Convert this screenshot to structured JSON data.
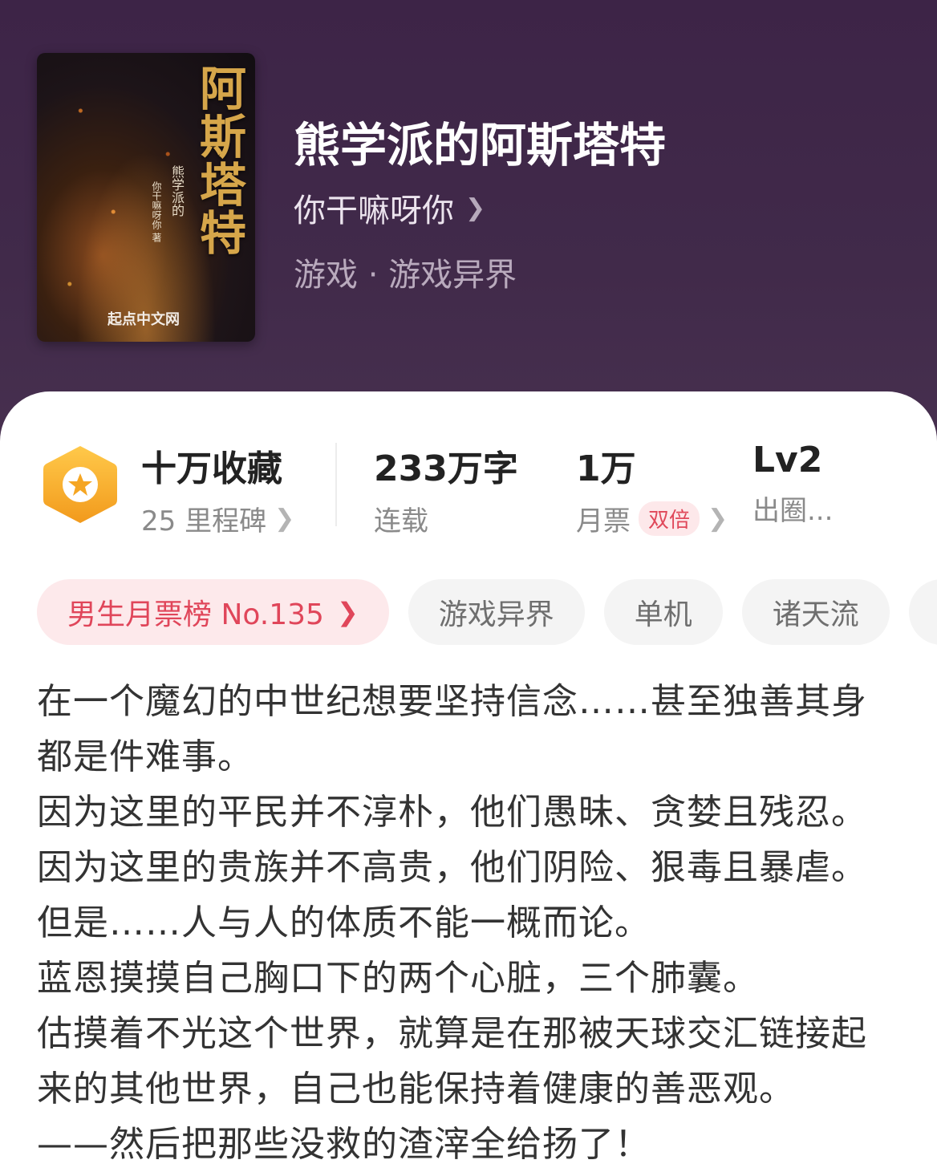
{
  "book": {
    "title": "熊学派的阿斯塔特",
    "author": "你干嘛呀你",
    "category": "游戏 · 游戏异界"
  },
  "cover": {
    "title": "阿斯塔特",
    "subtitle": "熊学派的",
    "author": "你干嘛呀你 著",
    "publisher_logo": "起点中文网"
  },
  "stats": {
    "collection": {
      "value": "十万收藏",
      "label": "25 里程碑"
    },
    "words": {
      "value": "233万字",
      "label": "连载"
    },
    "tickets": {
      "value": "1万",
      "label": "月票",
      "tag": "双倍"
    },
    "level": {
      "value": "Lv2",
      "label": "出圈..."
    }
  },
  "chips": [
    "男生月票榜 No.135",
    "游戏异界",
    "单机",
    "诸天流",
    "…"
  ],
  "intro": [
    "在一个魔幻的中世纪想要坚持信念……甚至独善其身",
    "都是件难事。",
    "因为这里的平民并不淳朴，他们愚昧、贪婪且残忍。",
    "因为这里的贵族并不高贵，他们阴险、狠毒且暴虐。",
    "但是……人与人的体质不能一概而论。",
    "蓝恩摸摸自己胸口下的两个心脏，三个肺囊。",
    "估摸着不光这个世界，就算是在那被天球交汇链接起",
    "来的其他世界，自己也能保持着健康的善恶观。",
    "——然后把那些没救的渣滓全给扬了！"
  ],
  "colors": {
    "header_bg": "#3f2748",
    "badge_orange": "#f5a623",
    "accent_red": "#e0465a"
  },
  "icons": {
    "badge": "star-hexagon-icon",
    "chevron": "chevron-right-icon"
  }
}
